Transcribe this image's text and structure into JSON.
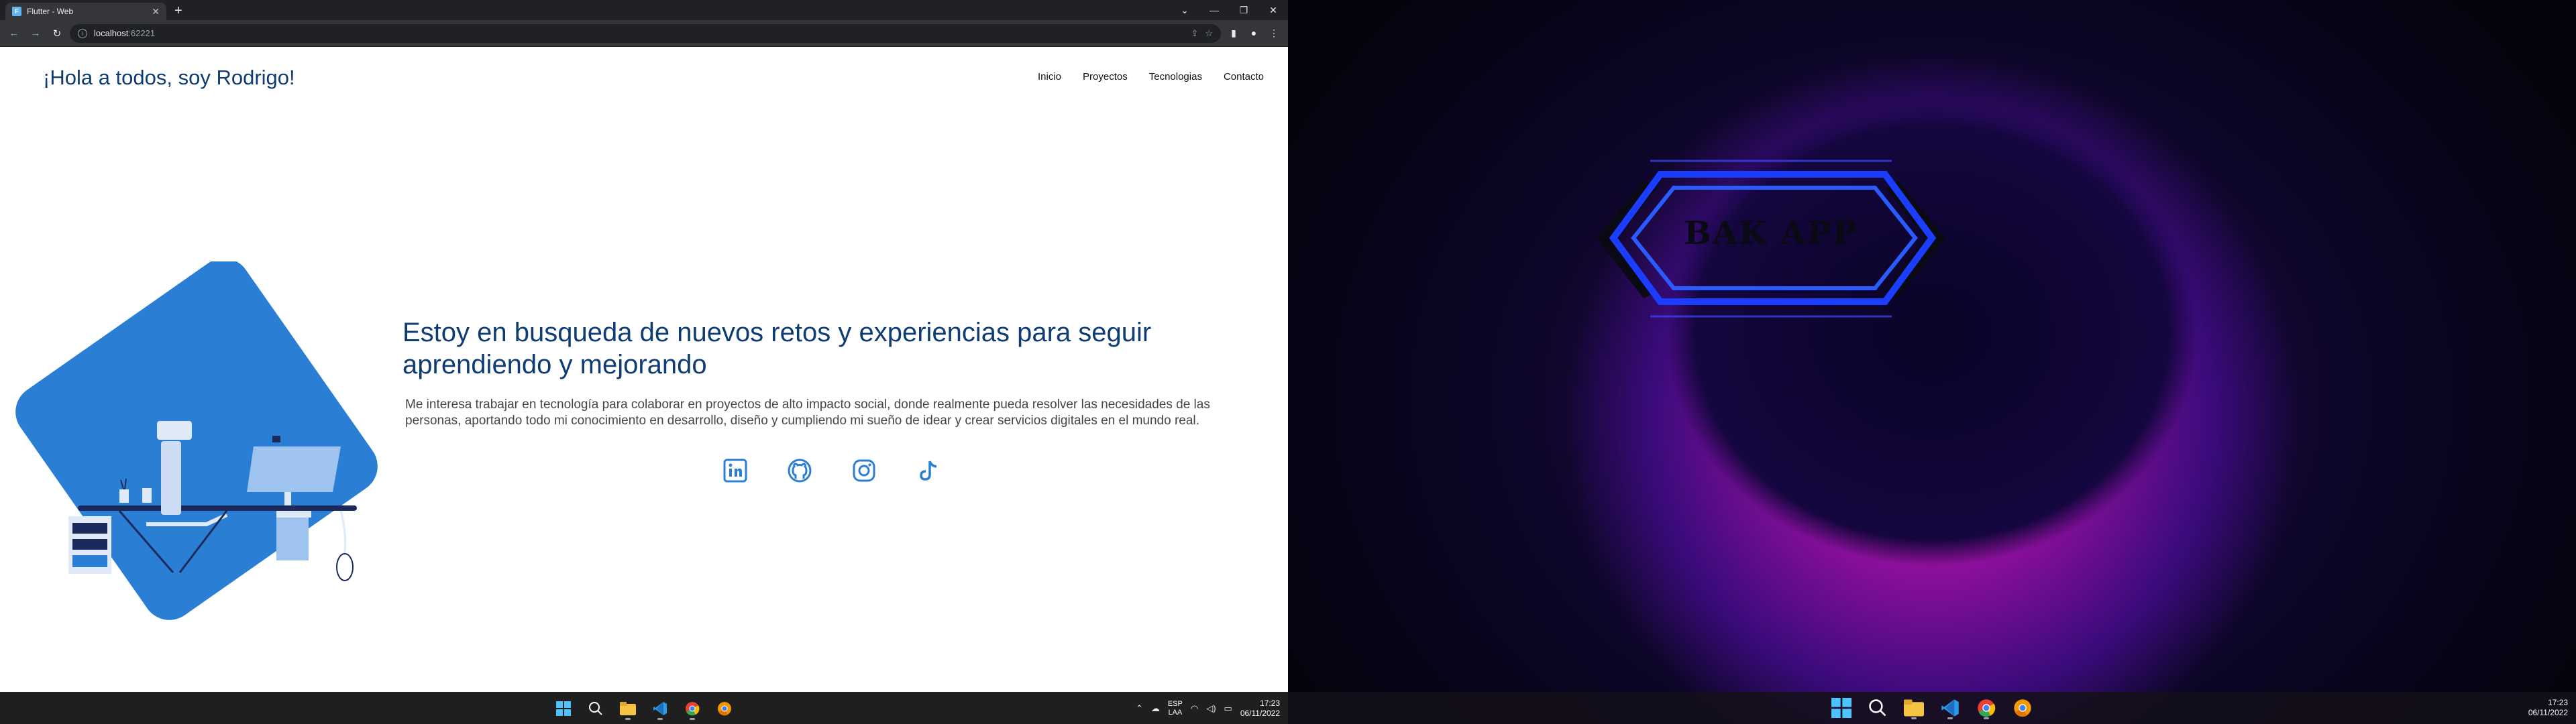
{
  "browser": {
    "tab_title": "Flutter - Web",
    "favicon_letter": "F",
    "url_host": "localhost",
    "url_port": ":62221"
  },
  "site": {
    "title": "¡Hola a todos, soy Rodrigo!",
    "nav": [
      "Inicio",
      "Proyectos",
      "Tecnologias",
      "Contacto"
    ],
    "hero_heading": "Estoy en busqueda de nuevos retos y experiencias para seguir aprendiendo y mejorando",
    "hero_body": "Me interesa trabajar en tecnología para colaborar en proyectos de alto impacto social, donde realmente pueda resolver las necesidades de las personas, aportando todo mi conocimiento en desarrollo, diseño y cumpliendo mi sueño de idear y crear servicios digitales en el mundo real.",
    "socials": [
      "linkedin-icon",
      "github-icon",
      "instagram-icon",
      "tiktok-icon"
    ],
    "accent_color": "#2a7fd4",
    "title_color": "#0f3d73"
  },
  "taskbar_left": {
    "lang_line1": "ESP",
    "lang_line2": "LAA",
    "time": "17:23",
    "date": "06/11/2022"
  },
  "desktop": {
    "logo_text": "BAK APP"
  },
  "taskbar_right": {
    "time": "17:23",
    "date": "06/11/2022"
  }
}
